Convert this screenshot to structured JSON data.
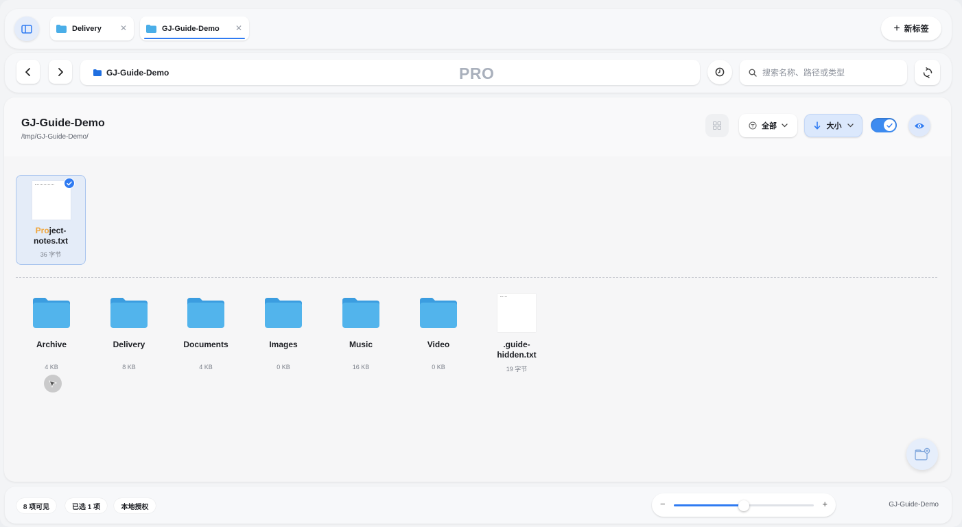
{
  "tabs": [
    {
      "label": "Delivery",
      "active": false
    },
    {
      "label": "GJ-Guide-Demo",
      "active": true
    }
  ],
  "new_tab_label": "新标签",
  "toolbar": {
    "path": "GJ-Guide-Demo",
    "badge": "PRO",
    "search_placeholder": "搜索名称、路径或类型"
  },
  "header": {
    "title": "GJ-Guide-Demo",
    "path": "/tmp/GJ-Guide-Demo/",
    "filter_label": "全部",
    "sort_label": "大小",
    "toggle_on": true
  },
  "selected": {
    "name_highlight": "Pro",
    "name_rest": "ject-",
    "name_line2": "notes.txt",
    "size": "36 字节",
    "selected": true
  },
  "items": [
    {
      "name": "Archive",
      "size": "4 KB",
      "type": "folder-icon"
    },
    {
      "name": "Delivery",
      "size": "8 KB",
      "type": "folder-icon"
    },
    {
      "name": "Documents",
      "size": "4 KB",
      "type": "folder-icon"
    },
    {
      "name": "Images",
      "size": "0 KB",
      "type": "folder-icon"
    },
    {
      "name": "Music",
      "size": "16 KB",
      "type": "folder-icon"
    },
    {
      "name": "Video",
      "size": "0 KB",
      "type": "folder-icon"
    },
    {
      "name": ".guide-hidden.txt",
      "name_line1": ".guide-",
      "name_line2": "hidden.txt",
      "size": "19 字节",
      "type": "text-file-icon"
    }
  ],
  "statusbar": {
    "visible_count": "8 项可见",
    "selected_count": "已选 1 项",
    "license": "本地授权",
    "zoom_level": 0.5,
    "location": "GJ-Guide-Demo"
  },
  "colors": {
    "accent": "#2f7bf2",
    "folder": "#4aaee8",
    "highlight": "#f0a53a"
  }
}
